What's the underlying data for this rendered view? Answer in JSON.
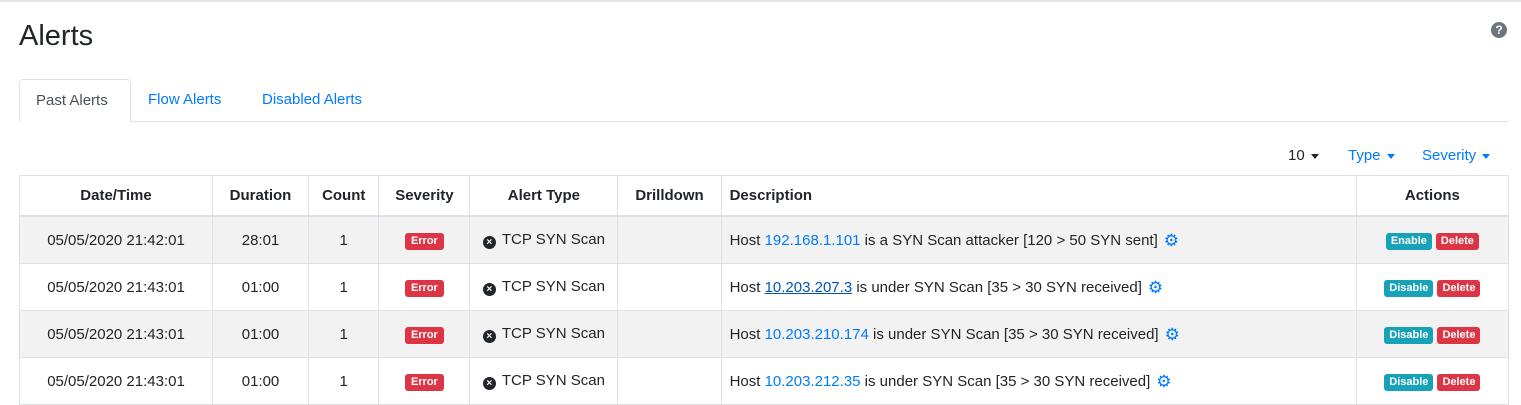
{
  "page": {
    "title": "Alerts",
    "help_icon": "question-circle-icon"
  },
  "tabs": [
    {
      "label": "Past Alerts",
      "active": true
    },
    {
      "label": "Flow Alerts",
      "active": false
    },
    {
      "label": "Disabled Alerts",
      "active": false
    }
  ],
  "controls": {
    "page_size": "10",
    "type": "Type",
    "severity": "Severity"
  },
  "table": {
    "headers": [
      "Date/Time",
      "Duration",
      "Count",
      "Severity",
      "Alert Type",
      "Drilldown",
      "Description",
      "Actions"
    ],
    "rows": [
      {
        "datetime": "05/05/2020 21:42:01",
        "duration": "28:01",
        "count": "1",
        "severity": "Error",
        "alert_type": "TCP SYN Scan",
        "drilldown": "",
        "desc_prefix": "Host ",
        "host": "192.168.1.101",
        "desc_suffix": " is a SYN Scan attacker [120 > 50 SYN sent]",
        "action1": "Enable",
        "action2": "Delete"
      },
      {
        "datetime": "05/05/2020 21:43:01",
        "duration": "01:00",
        "count": "1",
        "severity": "Error",
        "alert_type": "TCP SYN Scan",
        "drilldown": "",
        "desc_prefix": "Host ",
        "host": "10.203.207.3",
        "desc_suffix": " is under SYN Scan [35 > 30 SYN received]",
        "action1": "Disable",
        "action2": "Delete"
      },
      {
        "datetime": "05/05/2020 21:43:01",
        "duration": "01:00",
        "count": "1",
        "severity": "Error",
        "alert_type": "TCP SYN Scan",
        "drilldown": "",
        "desc_prefix": "Host ",
        "host": "10.203.210.174",
        "desc_suffix": " is under SYN Scan [35 > 30 SYN received]",
        "action1": "Disable",
        "action2": "Delete"
      },
      {
        "datetime": "05/05/2020 21:43:01",
        "duration": "01:00",
        "count": "1",
        "severity": "Error",
        "alert_type": "TCP SYN Scan",
        "drilldown": "",
        "desc_prefix": "Host ",
        "host": "10.203.212.35",
        "desc_suffix": " is under SYN Scan [35 > 30 SYN received]",
        "action1": "Disable",
        "action2": "Delete"
      }
    ]
  },
  "icons": {
    "alert_type": "times-circle-icon",
    "config": "gear-icon"
  },
  "colors": {
    "link": "#007bff",
    "error": "#dc3545",
    "info": "#17a2b8"
  }
}
